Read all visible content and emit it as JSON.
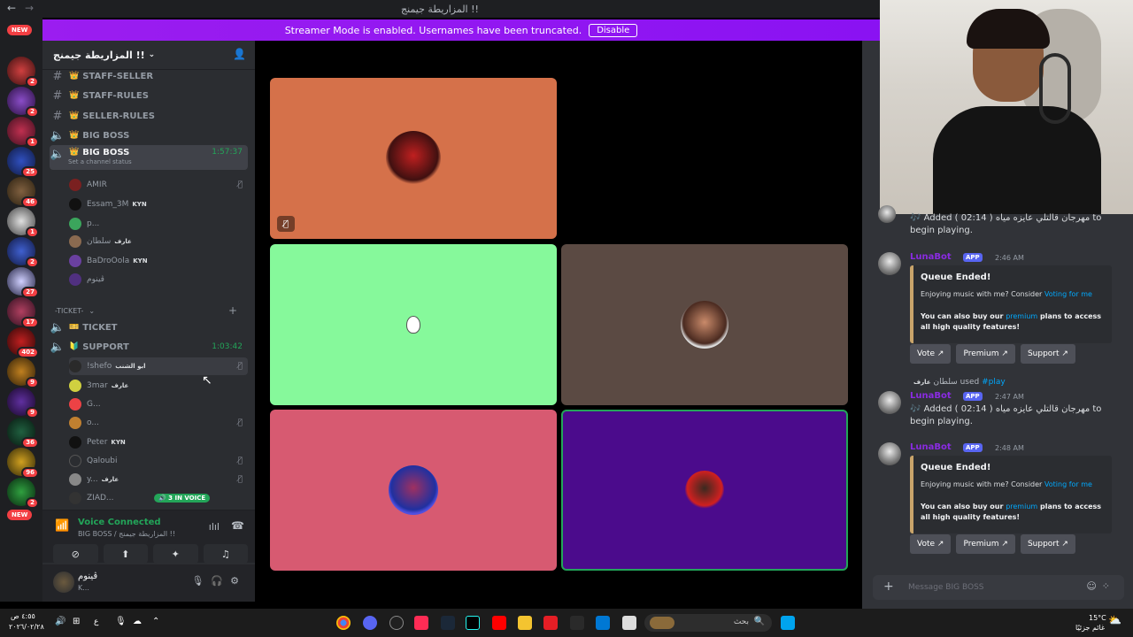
{
  "title_bar": {
    "title": "المزاريطة جيمنج !!",
    "back": "←",
    "forward": "→"
  },
  "banner": {
    "text": "Streamer Mode is enabled. Usernames have been truncated.",
    "button": "Disable"
  },
  "guild_badges": [
    "2",
    "2",
    "1",
    "25",
    "46",
    "1",
    "2",
    "27",
    "17",
    "402",
    "9",
    "9",
    "36",
    "96",
    "2"
  ],
  "guild_new": "NEW",
  "server": {
    "name": "المزاريطة جيمنج !!"
  },
  "channels": [
    {
      "name": "STAFF-SELLER"
    },
    {
      "name": "STAFF-RULES"
    },
    {
      "name": "SELLER-RULES"
    },
    {
      "name": "BIG BOSS"
    },
    {
      "name": "BIG BOSS",
      "timer": "1:57:37",
      "status": "Set a channel status"
    }
  ],
  "voice_users_a": [
    {
      "name": "AMIR"
    },
    {
      "name": "Essam_3M",
      "tag": "KYN"
    },
    {
      "name": "p..."
    },
    {
      "name": "سلطان",
      "tag": "عارف"
    },
    {
      "name": "BaDroOola",
      "tag": "KYN"
    },
    {
      "name": "ڤينوم"
    }
  ],
  "ticket_category": "-TICKET-",
  "ticket_channel": "TICKET",
  "support_channel": {
    "name": "SUPPORT",
    "timer": "1:03:42"
  },
  "voice_users_b": [
    {
      "name": "!shefo",
      "tag": "ابو الشنب"
    },
    {
      "name": "3mar",
      "tag": "عارف"
    },
    {
      "name": "G..."
    },
    {
      "name": "o..."
    },
    {
      "name": "Peter",
      "tag": "KYN"
    },
    {
      "name": "Qaloubi"
    },
    {
      "name": "y...",
      "tag": "عارف"
    },
    {
      "name": "ZIAD..."
    }
  ],
  "in_voice": "3 IN VOICE",
  "voice_panel": {
    "title": "Voice Connected",
    "sub": "BIG BOSS / المزاريطة جيمنج !!"
  },
  "user_panel": {
    "name": "ڤينوم",
    "status": "K..."
  },
  "chat": {
    "msg1_text": "Added ( 02:14 ) مهرجان قالتلي عايزه مياه to begin playing.",
    "bot_name": "LunaBot",
    "app_badge": "APP",
    "time1": "2:46 AM",
    "embed1": {
      "title": "Queue Ended!",
      "text_a": "Enjoying music with me? Consider ",
      "link_a": "Voting for me",
      "text_b1": "You can also buy our ",
      "link_b": "premium",
      "text_b2": " plans to access all high quality features!"
    },
    "buttons": [
      "Vote",
      "Premium",
      "Support"
    ],
    "used_line": {
      "user": "سلطان",
      "tag": "عارف",
      "used": "used",
      "cmd": "play"
    },
    "time2": "2:47 AM",
    "msg2_text": "Added ( 02:14 ) مهرجان قالتلي عايزه مياه to begin playing.",
    "time3": "2:48 AM",
    "placeholder": "Message BIG BOSS"
  },
  "taskbar": {
    "clock": "٤:٥٥ ص",
    "date": "٢٠٢٦/٠٢/٢٨",
    "search": "بحث",
    "weather": "15°C",
    "weather_sub": "غائم جزئيًا",
    "lang": "ع"
  }
}
